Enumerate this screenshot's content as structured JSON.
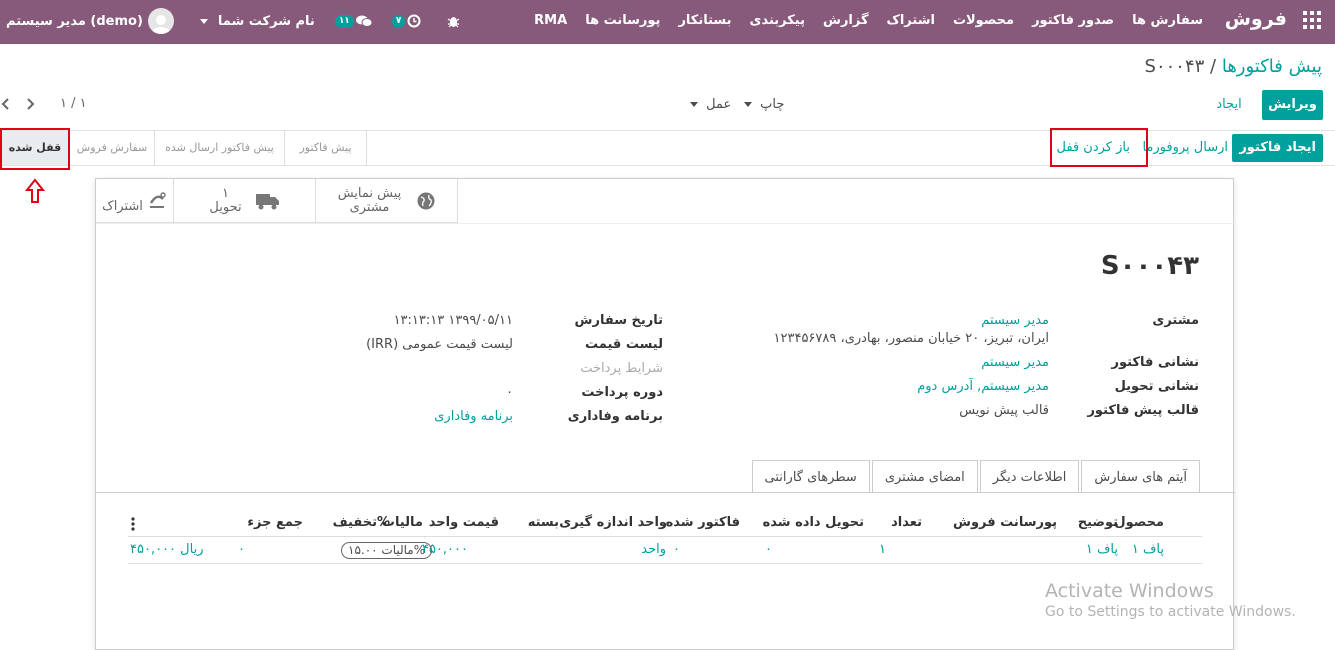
{
  "topbar": {
    "brand": "فروش",
    "menu": [
      "سفارش ها",
      "صدور فاکتور",
      "محصولات",
      "اشتراک",
      "گزارش",
      "پیکربندی",
      "بستانکار",
      "پورسانت ها",
      "RMA"
    ],
    "user": "مدیر سیستم (demo)",
    "company": "نام شرکت شما",
    "messages_count": "۱۱",
    "activities_count": "۷",
    "icons": {
      "apps": "apps-grid-icon",
      "bug": "bug-icon",
      "activity": "clock-icon",
      "chat": "chat-icon",
      "avatar": "user-avatar-icon"
    }
  },
  "control_panel": {
    "breadcrumb_parent": "پیش فاکتورها",
    "breadcrumb_sep": "/",
    "breadcrumb_current": "S۰۰۰۴۳",
    "edit": "ویرایش",
    "create": "ایجاد",
    "print": "چاپ",
    "action": "عمل",
    "pager": "۱ / ۱"
  },
  "statusbar": {
    "create_invoice": "ایجاد فاکتور",
    "send_proforma": "ارسال پروفورما",
    "unlock": "باز کردن قفل",
    "stages": [
      "پیش فاکتور",
      "پیش فاکتور ارسال شده",
      "سفارش فروش",
      "قفل شده"
    ]
  },
  "smart_buttons": {
    "subscription": "اشتراک",
    "delivery_count": "۱",
    "delivery_label": "تحویل",
    "preview_line1": "پیش نمایش",
    "preview_line2": "مشتری"
  },
  "form": {
    "name": "S۰۰۰۴۳",
    "left": {
      "customer_label": "مشتری",
      "customer": "مدیر سیستم",
      "customer_address": "ایران، تبریز، ۲۰ خیابان منصور، بهادری، ۱۲۳۴۵۶۷۸۹",
      "invoice_address_label": "نشانی فاکتور",
      "invoice_address": "مدیر سیستم",
      "delivery_address_label": "نشانی تحویل",
      "delivery_address": "مدیر سیستم, آدرس دوم",
      "template_label": "قالب پیش فاکتور",
      "template": "قالب پیش نویس"
    },
    "right": {
      "order_date_label": "تاریخ سفارش",
      "order_date": "۱۳۹۹/۰۵/۱۱ ۱۳:۱۳:۱۳",
      "pricelist_label": "لیست قیمت",
      "pricelist": "لیست قیمت عمومی (IRR)",
      "payment_terms_label": "شرایط پرداخت",
      "payment_period_label": "دوره پرداخت",
      "payment_period": "۰",
      "loyalty_label": "برنامه وفاداری",
      "loyalty": "برنامه وفاداری"
    }
  },
  "tabs": [
    "آیتم های سفارش",
    "اطلاعات دیگر",
    "امضای مشتری",
    "سطرهای گارانتی"
  ],
  "order_lines": {
    "columns": [
      "محصول",
      "توضیح",
      "پورسانت فروش",
      "تعداد",
      "تحویل داده شده",
      "فاکتور شده",
      "واحد اندازه گیری",
      "بسته",
      "قیمت واحد",
      "مالیات",
      "تخفیف%",
      "جمع جزء"
    ],
    "rows": [
      {
        "product": "پاف ۱",
        "description": "پاف ۱",
        "commission": "",
        "qty": "۱",
        "delivered": "۰",
        "invoiced": "۰",
        "uom": "واحد",
        "package": "",
        "price": "۴۵۰,۰۰۰",
        "tax": "مالیات ۱۵.۰۰%",
        "discount": "۰",
        "subtotal": "۴۵۰,۰۰۰ ریال"
      }
    ]
  },
  "watermark": {
    "line1": "Activate Windows",
    "line2": "Go to Settings to activate Windows."
  }
}
